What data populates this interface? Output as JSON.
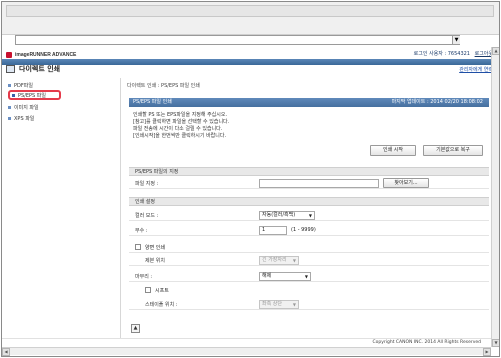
{
  "header": {
    "brand": "imageRUNNER ADVANCE",
    "login_info": "로그인 사용자 : 7654321",
    "logout_label": "로그아웃",
    "page_title": "다이렉트 인쇄",
    "help_link": "관리자에게 연락"
  },
  "sidebar": {
    "items": [
      {
        "label": "PDF파일"
      },
      {
        "label": "PS/EPS 파일"
      },
      {
        "label": "이미지 파일"
      },
      {
        "label": "XPS 파일"
      }
    ]
  },
  "main": {
    "breadcrumb": "다이렉트 인쇄 : PS/EPS 파일 인쇄",
    "print_section": {
      "title": "PS/EPS 파일 인쇄",
      "last_updated": "마지막 업데이트 : 2014 02/20 18:08:02",
      "messages": [
        "인쇄할 PS 또는 EPS파일을 지정해 주십시오.",
        "[참고]를 클릭하면 파일을 선택할 수 있습니다.",
        "파일 전송에 시간이 다소 걸릴 수 있습니다.",
        "[인쇄시작]을 한번씩만 클릭하시기 바랍니다."
      ],
      "start_button": "인쇄 시작",
      "reset_button": "기본값으로 복구"
    },
    "file_section": {
      "title": "PS/EPS 파일의 지정",
      "file_label": "파일 지정 :",
      "browse_button": "찾아보기..."
    },
    "settings": {
      "title": "인쇄 설정",
      "color_mode_label": "컬러 모드 :",
      "color_mode_value": "자동(컬러/흑백)",
      "copies_label": "부수 :",
      "copies_value": "1",
      "copies_range": "(1 - 9999)",
      "duplex_label": "양면 인쇄",
      "binding_label": "제본 위치",
      "binding_value": "긴 가장자리",
      "finishing_label": "마무리 :",
      "finishing_value": "해제",
      "staple_label": "스테이플 위치 :",
      "staple_value": "좌측 상단",
      "shift_label": "시프트"
    }
  },
  "footer": {
    "copyright": "Copyright CANON INC. 2014 All Rights Reserved"
  },
  "colors": {
    "section_bar": "#46709f",
    "active_nav_outline": "#e53b4b"
  }
}
